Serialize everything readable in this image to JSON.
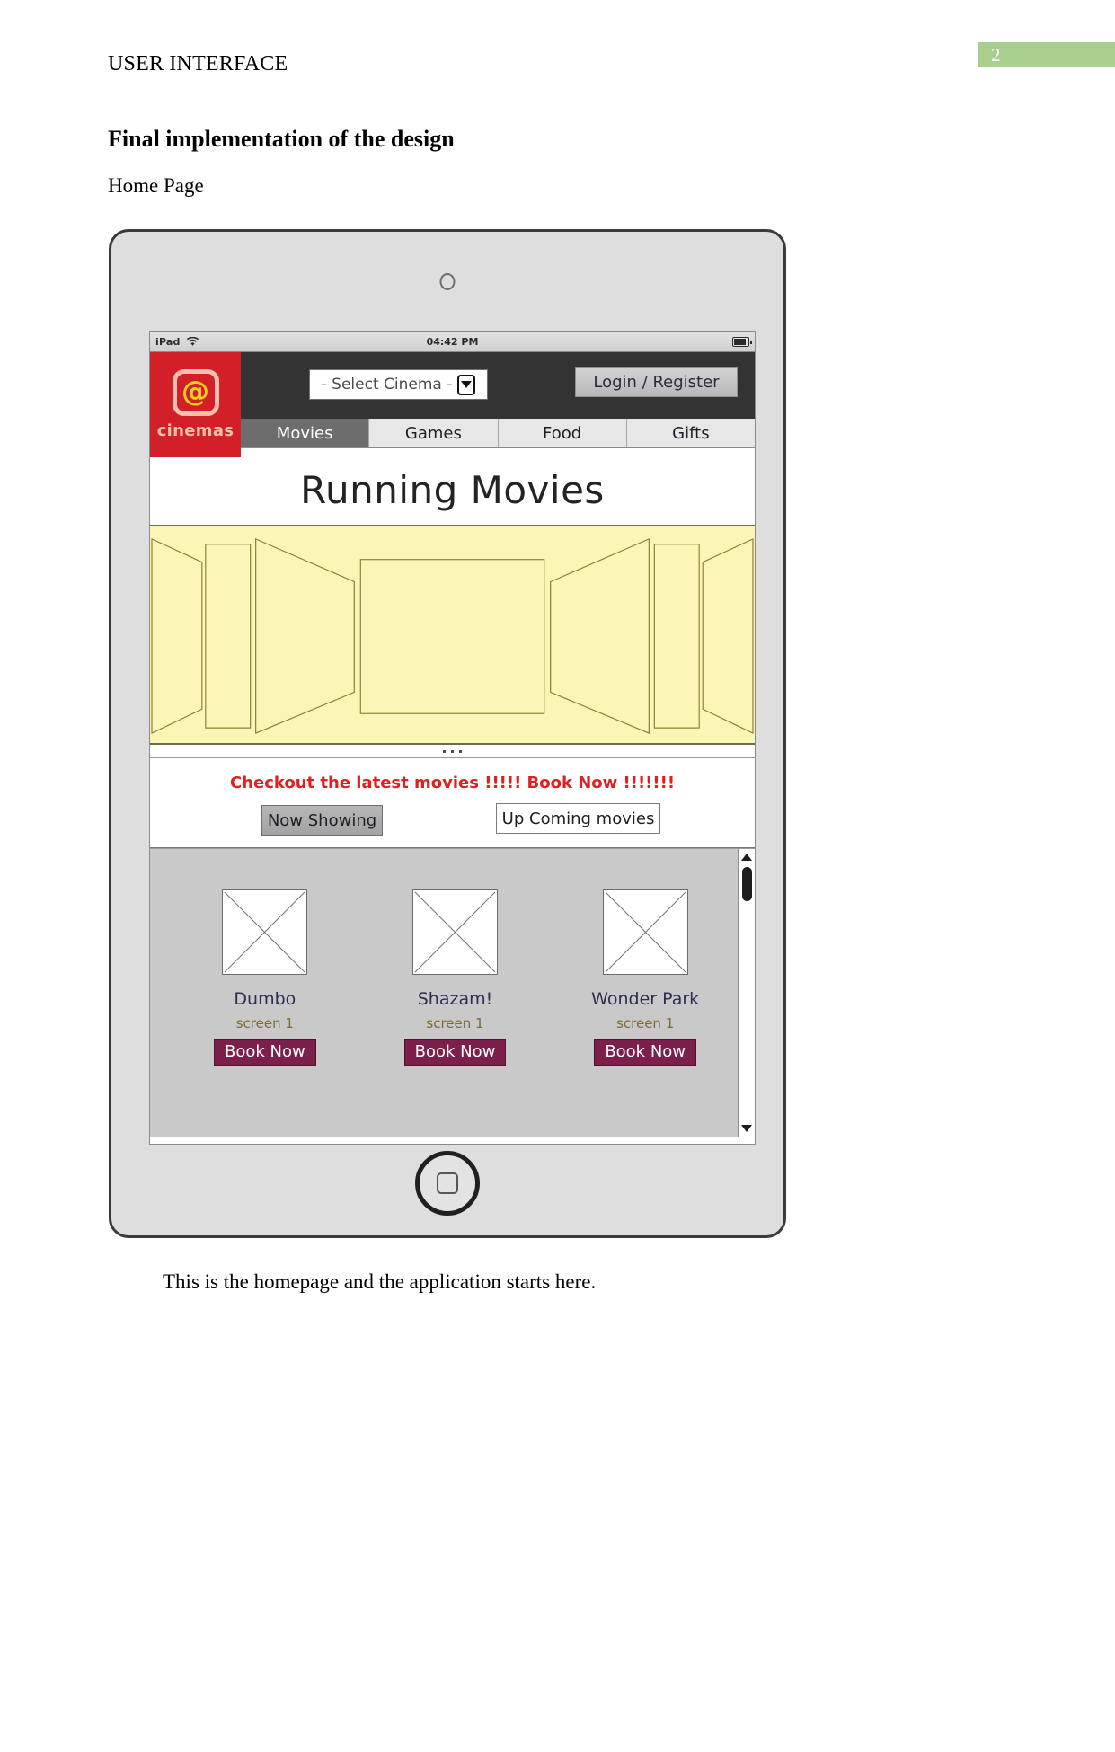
{
  "document": {
    "running_header": "USER INTERFACE",
    "page_number": "2",
    "heading": "Final implementation of the design",
    "subheading": "Home Page",
    "caption": "This is the homepage and the application starts here."
  },
  "device": {
    "kind": "tablet",
    "camera_icon": "camera-icon",
    "home_button_icon": "home-square-icon"
  },
  "statusbar": {
    "device_label": "iPad",
    "wifi_icon": "wifi-icon",
    "time": "04:42 PM",
    "battery_icon": "battery-icon"
  },
  "app": {
    "logo": {
      "mark": "@",
      "word": "cinemas"
    },
    "cinema_select": {
      "value": "- Select Cinema -",
      "arrow_icon": "chevron-down-icon"
    },
    "login_button": "Login  / Register",
    "tabs": [
      {
        "label": "Movies",
        "active": true
      },
      {
        "label": "Games",
        "active": false
      },
      {
        "label": "Food",
        "active": false
      },
      {
        "label": "Gifts",
        "active": false
      }
    ],
    "banner_title": "Running Movies",
    "carousel": {
      "dots": 3,
      "background": "#fbf6b5",
      "stroke": "#8a8234"
    },
    "promo": {
      "text": "Checkout the latest movies !!!!!   Book Now !!!!!!!",
      "color": "#e02020",
      "now_showing_button": "Now Showing",
      "upcoming_button": "Up Coming movies"
    },
    "movies": [
      {
        "title": "Dumbo",
        "screen": "screen 1",
        "book_label": "Book Now"
      },
      {
        "title": "Shazam!",
        "screen": "screen 1",
        "book_label": "Book Now"
      },
      {
        "title": "Wonder Park",
        "screen": "screen 1",
        "book_label": "Book Now"
      }
    ],
    "scrollbar": {
      "up_icon": "arrow-up-icon",
      "down_icon": "arrow-down-icon"
    },
    "colors": {
      "logo_red": "#d32028",
      "header_dark": "#333333",
      "book_now": "#7d1f4b",
      "badge_green": "#a8cf8e",
      "movie_title": "#2d2d52",
      "screen_label": "#7d6a35"
    }
  }
}
